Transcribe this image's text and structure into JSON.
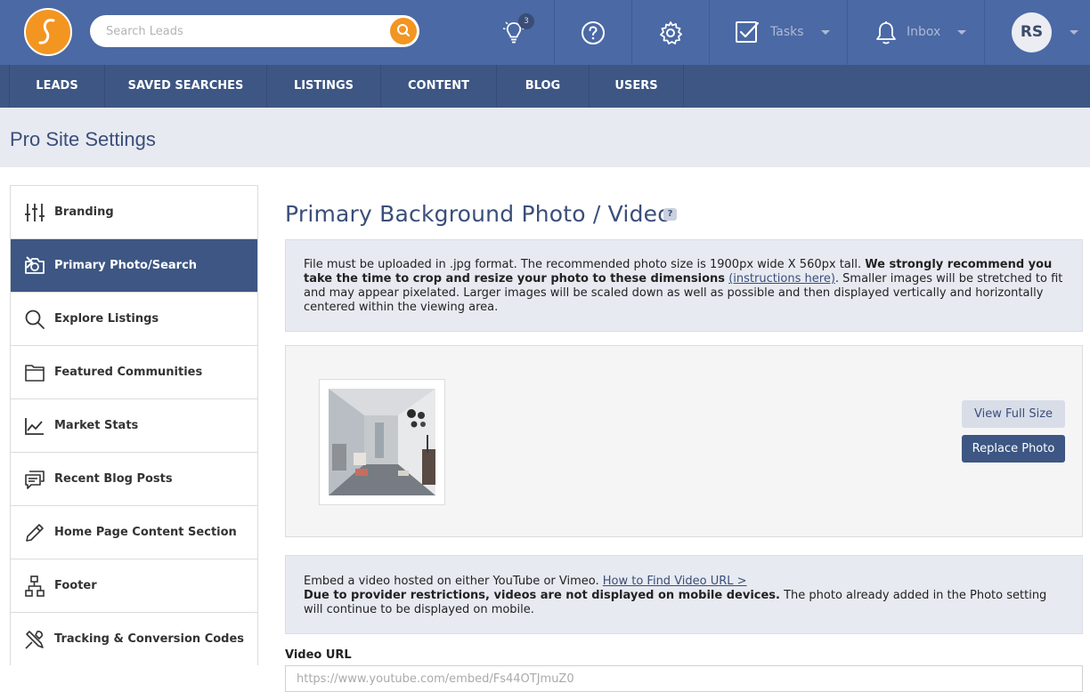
{
  "header": {
    "search_placeholder": "Search Leads",
    "notification_count": "3",
    "tasks_label": "Tasks",
    "inbox_label": "Inbox",
    "avatar_initials": "RS",
    "brand_color": "#4a69a5",
    "accent_color": "#f39521"
  },
  "nav": {
    "items": [
      "LEADS",
      "SAVED SEARCHES",
      "LISTINGS",
      "CONTENT",
      "BLOG",
      "USERS"
    ]
  },
  "page": {
    "title": "Pro Site Settings"
  },
  "sidebar": {
    "items": [
      {
        "label": "Branding",
        "icon": "sliders-icon",
        "active": false
      },
      {
        "label": "Primary Photo/Search",
        "icon": "camera-icon",
        "active": true
      },
      {
        "label": "Explore Listings",
        "icon": "search-icon",
        "active": false
      },
      {
        "label": "Featured Communities",
        "icon": "folder-icon",
        "active": false
      },
      {
        "label": "Market Stats",
        "icon": "chart-line-icon",
        "active": false
      },
      {
        "label": "Recent Blog Posts",
        "icon": "chat-icon",
        "active": false
      },
      {
        "label": "Home Page Content Section",
        "icon": "pencil-icon",
        "active": false
      },
      {
        "label": "Footer",
        "icon": "sitemap-icon",
        "active": false
      },
      {
        "label": "Tracking & Conversion Codes",
        "icon": "tools-icon",
        "active": false
      }
    ]
  },
  "main": {
    "title": "Primary Background Photo / Video",
    "help": "?",
    "photo_info": {
      "text1": "File must be uploaded in .jpg format. The recommended photo size is 1900px wide X 560px tall. ",
      "bold": "We strongly recommend you take the time to crop and resize your photo to these dimensions",
      "link": "(instructions here)",
      "text2": ". Smaller images will be stretched to fit and may appear pixelated. Larger images will be scaled down as well as possible and then displayed vertically and horizontally centered within the viewing area."
    },
    "view_full_size": "View Full Size",
    "replace_photo": "Replace Photo",
    "video_info": {
      "text1": "Embed a video hosted on either YouTube or Vimeo. ",
      "link": "How to Find Video URL >",
      "bold": "Due to provider restrictions, videos are not displayed on mobile devices.",
      "text2": " The photo already added in the Photo setting will continue to be displayed on mobile."
    },
    "video_url_label": "Video URL",
    "video_url_placeholder": "https://www.youtube.com/embed/Fs44OTJmuZ0"
  }
}
